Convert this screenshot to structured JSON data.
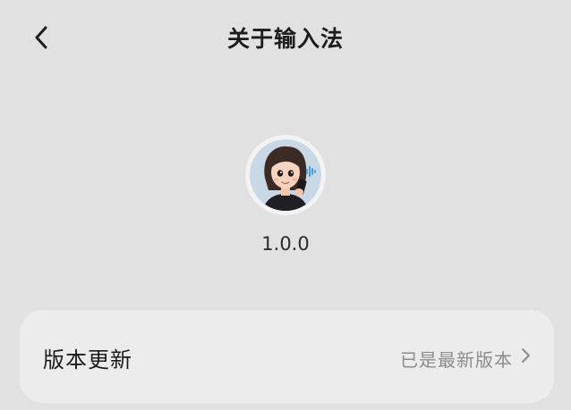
{
  "header": {
    "title": "关于输入法",
    "back_icon": "chevron-left-icon"
  },
  "app": {
    "avatar_icon": "cartoon-woman-with-phone-avatar",
    "version": "1.0.0"
  },
  "settings": {
    "rows": [
      {
        "label": "版本更新",
        "value": "已是最新版本",
        "icon": "chevron-right-icon"
      }
    ]
  },
  "colors": {
    "background": "#e1e1e1",
    "card": "#ececec",
    "secondary_text": "#8c8c8c",
    "voice_wave": "#4aa0e8"
  }
}
